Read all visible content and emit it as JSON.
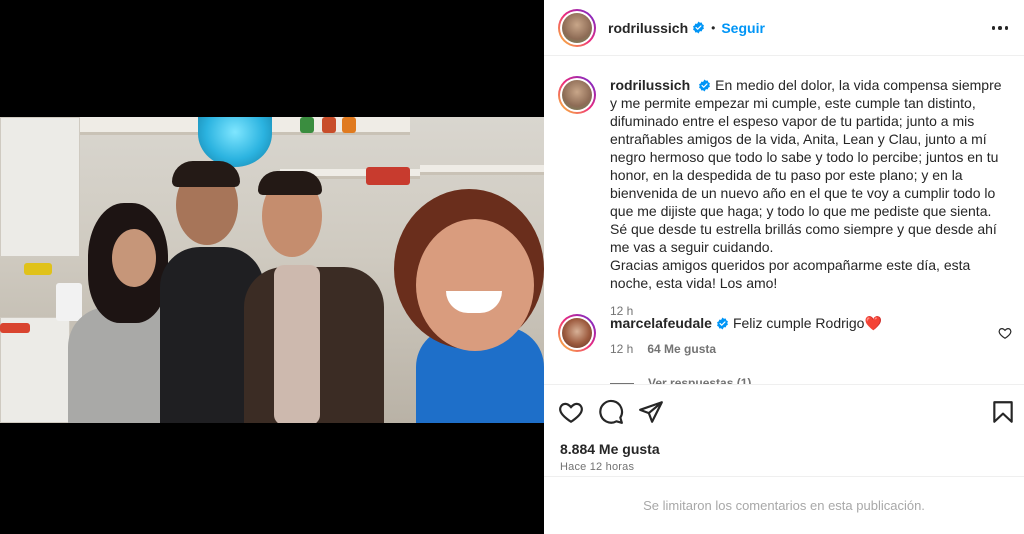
{
  "post": {
    "author": "rodrilussich",
    "follow_label": "Seguir",
    "separator": "•"
  },
  "caption": {
    "author": "rodrilussich",
    "text": "En medio del dolor, la vida compensa siempre y me permite empezar mi cumple, este cumple tan distinto, difuminado entre el espeso vapor de tu partida; junto a mis entrañables amigos de la vida, Anita, Lean y Clau, junto a mí negro hermoso que todo lo sabe y todo lo percibe; juntos en tu honor, en la despedida de tu paso por este plano; y en la bienvenida de un nuevo año en el que te voy a cumplir todo lo que me dijiste que haga; y todo lo que me pediste que sienta. Sé que desde tu estrella brillás como siempre y que desde ahí me vas a seguir cuidando.\nGracias amigos queridos por acompañarme este día, esta noche, esta vida! Los amo!",
    "time": "12 h"
  },
  "comment": {
    "author": "marcelafeudale",
    "text": "Feliz cumple Rodrigo",
    "emoji": "❤️",
    "time": "12 h",
    "likes": "64 Me gusta"
  },
  "view_replies": "Ver respuestas (1)",
  "stats": {
    "likes": "8.884 Me gusta",
    "time_ago": "Hace 12 horas"
  },
  "footer": {
    "comments_limited": "Se limitaron los comentarios en esta publicación."
  },
  "colors": {
    "accent": "#0095f6",
    "verified": "#0095f6",
    "heart": "#ed4956",
    "muted": "#737373",
    "text": "#262626"
  },
  "icons": [
    "verified-badge-icon",
    "more-options-icon",
    "like-heart-icon",
    "comment-icon",
    "share-icon",
    "bookmark-icon",
    "comment-like-icon"
  ]
}
